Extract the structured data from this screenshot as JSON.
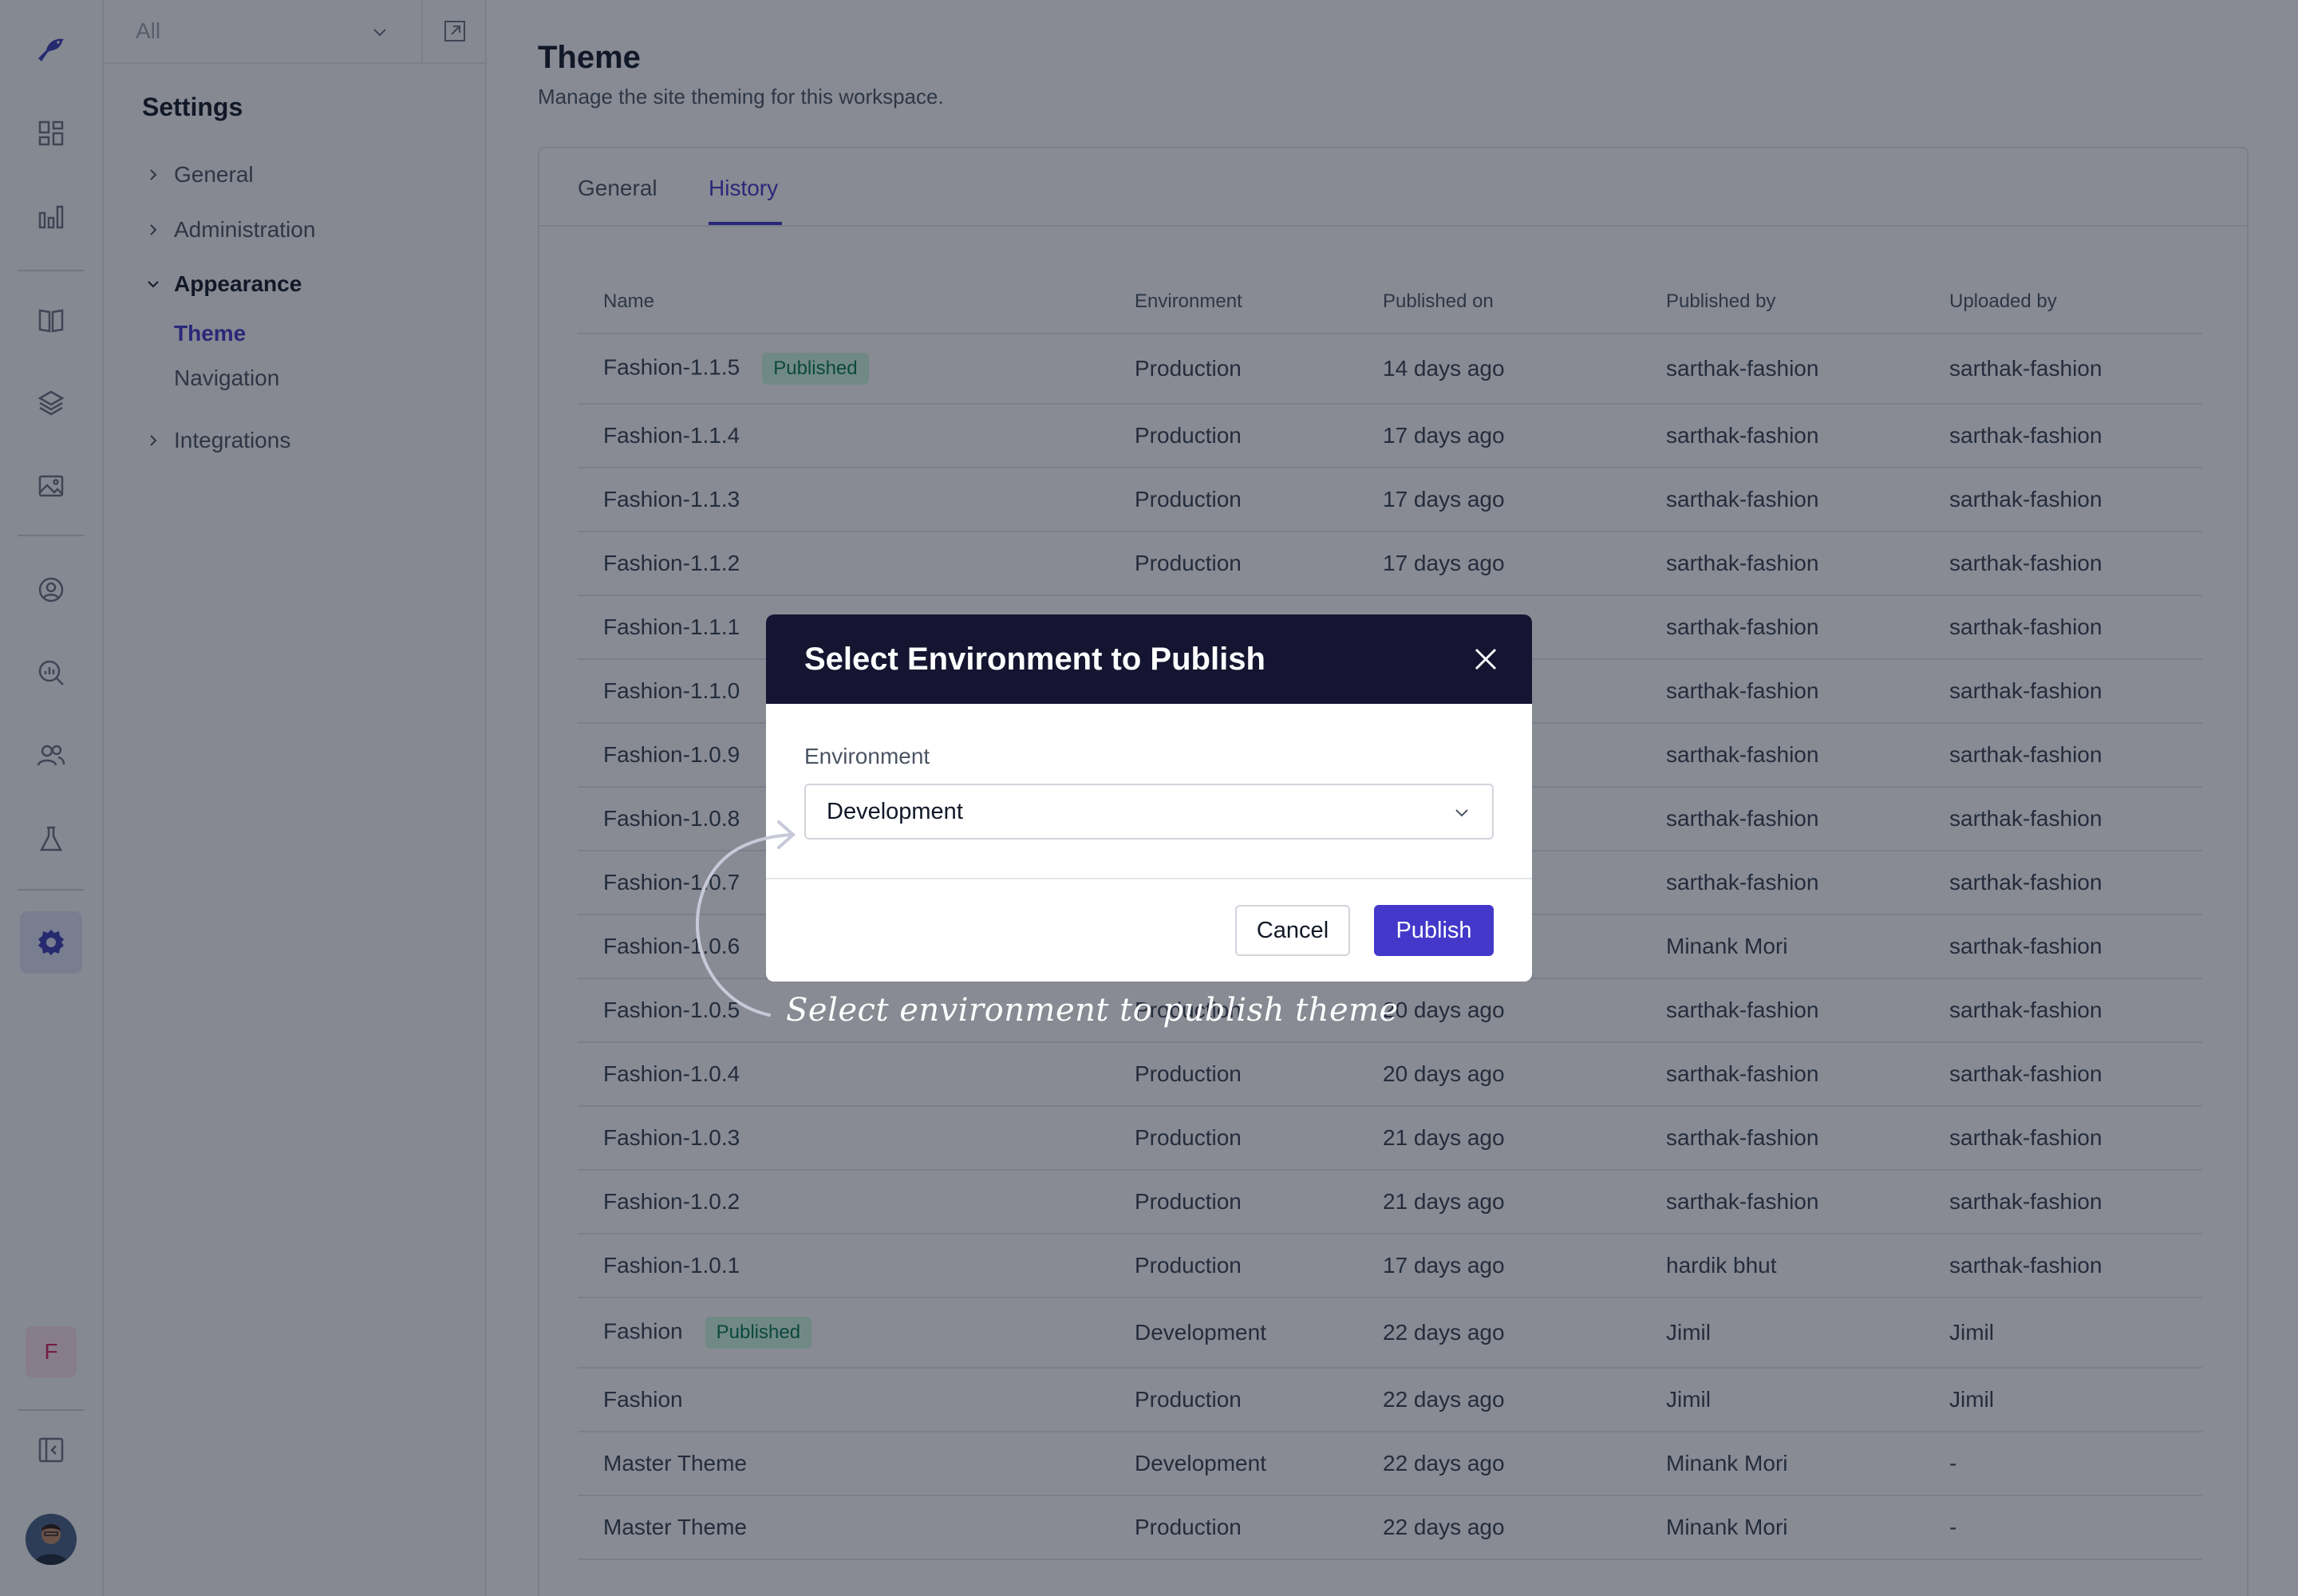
{
  "workspace_select": {
    "value": "All"
  },
  "sidebar": {
    "title": "Settings",
    "items": [
      {
        "label": "General"
      },
      {
        "label": "Administration"
      },
      {
        "label": "Appearance"
      },
      {
        "label": "Integrations"
      }
    ],
    "appearance_children": [
      {
        "label": "Theme"
      },
      {
        "label": "Navigation"
      }
    ]
  },
  "rail": {
    "badge_letter": "F",
    "accent_color": "#4338ca"
  },
  "page": {
    "title": "Theme",
    "subtitle": "Manage the site theming for this workspace."
  },
  "tabs": [
    {
      "label": "General"
    },
    {
      "label": "History"
    }
  ],
  "table": {
    "columns": [
      "Name",
      "Environment",
      "Published on",
      "Published by",
      "Uploaded by"
    ],
    "published_badge": "Published",
    "rows": [
      {
        "name": "Fashion-1.1.5",
        "badge": true,
        "env": "Production",
        "on": "14 days ago",
        "by": "sarthak-fashion",
        "up": "sarthak-fashion"
      },
      {
        "name": "Fashion-1.1.4",
        "badge": false,
        "env": "Production",
        "on": "17 days ago",
        "by": "sarthak-fashion",
        "up": "sarthak-fashion"
      },
      {
        "name": "Fashion-1.1.3",
        "badge": false,
        "env": "Production",
        "on": "17 days ago",
        "by": "sarthak-fashion",
        "up": "sarthak-fashion"
      },
      {
        "name": "Fashion-1.1.2",
        "badge": false,
        "env": "Production",
        "on": "17 days ago",
        "by": "sarthak-fashion",
        "up": "sarthak-fashion"
      },
      {
        "name": "Fashion-1.1.1",
        "badge": false,
        "env": "",
        "on": "",
        "by": "sarthak-fashion",
        "up": "sarthak-fashion"
      },
      {
        "name": "Fashion-1.1.0",
        "badge": false,
        "env": "",
        "on": "",
        "by": "sarthak-fashion",
        "up": "sarthak-fashion"
      },
      {
        "name": "Fashion-1.0.9",
        "badge": false,
        "env": "",
        "on": "",
        "by": "sarthak-fashion",
        "up": "sarthak-fashion"
      },
      {
        "name": "Fashion-1.0.8",
        "badge": false,
        "env": "",
        "on": "",
        "by": "sarthak-fashion",
        "up": "sarthak-fashion"
      },
      {
        "name": "Fashion-1.0.7",
        "badge": false,
        "env": "",
        "on": "",
        "by": "sarthak-fashion",
        "up": "sarthak-fashion"
      },
      {
        "name": "Fashion-1.0.6",
        "badge": false,
        "env": "",
        "on": "",
        "by": "Minank Mori",
        "up": "sarthak-fashion"
      },
      {
        "name": "Fashion-1.0.5",
        "badge": false,
        "env": "Production",
        "on": "20 days ago",
        "by": "sarthak-fashion",
        "up": "sarthak-fashion"
      },
      {
        "name": "Fashion-1.0.4",
        "badge": false,
        "env": "Production",
        "on": "20 days ago",
        "by": "sarthak-fashion",
        "up": "sarthak-fashion"
      },
      {
        "name": "Fashion-1.0.3",
        "badge": false,
        "env": "Production",
        "on": "21 days ago",
        "by": "sarthak-fashion",
        "up": "sarthak-fashion"
      },
      {
        "name": "Fashion-1.0.2",
        "badge": false,
        "env": "Production",
        "on": "21 days ago",
        "by": "sarthak-fashion",
        "up": "sarthak-fashion"
      },
      {
        "name": "Fashion-1.0.1",
        "badge": false,
        "env": "Production",
        "on": "17 days ago",
        "by": "hardik bhut",
        "up": "sarthak-fashion"
      },
      {
        "name": "Fashion",
        "badge": true,
        "env": "Development",
        "on": "22 days ago",
        "by": "Jimil",
        "up": "Jimil"
      },
      {
        "name": "Fashion",
        "badge": false,
        "env": "Production",
        "on": "22 days ago",
        "by": "Jimil",
        "up": "Jimil"
      },
      {
        "name": "Master Theme",
        "badge": false,
        "env": "Development",
        "on": "22 days ago",
        "by": "Minank Mori",
        "up": "-"
      },
      {
        "name": "Master Theme",
        "badge": false,
        "env": "Production",
        "on": "22 days ago",
        "by": "Minank Mori",
        "up": "-"
      }
    ]
  },
  "modal": {
    "title": "Select Environment to Publish",
    "field_label": "Environment",
    "selected_value": "Development",
    "cancel_label": "Cancel",
    "publish_label": "Publish"
  },
  "annotation": {
    "text": "Select environment to publish theme"
  }
}
